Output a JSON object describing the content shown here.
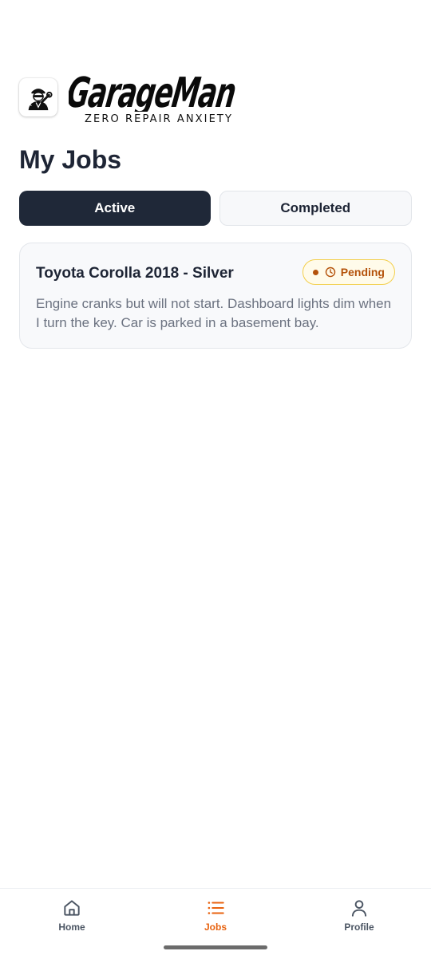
{
  "brand": {
    "icon": "mechanic-logo-icon",
    "name": "GarageMan",
    "tagline": "ZERO REPAIR ANXIETY"
  },
  "page": {
    "title": "My Jobs"
  },
  "tabs": [
    {
      "label": "Active",
      "selected": true
    },
    {
      "label": "Completed",
      "selected": false
    }
  ],
  "jobs": [
    {
      "title": "Toyota Corolla 2018 - Silver",
      "status": "Pending",
      "status_icon": "clock-icon",
      "description": "Engine cranks but will not start. Dashboard lights dim when I turn the key. Car is parked in a basement bay."
    }
  ],
  "nav": {
    "items": [
      {
        "label": "Home",
        "icon": "home-icon",
        "active": false
      },
      {
        "label": "Jobs",
        "icon": "list-icon",
        "active": true
      },
      {
        "label": "Profile",
        "icon": "person-icon",
        "active": false
      }
    ]
  },
  "colors": {
    "primary_dark": "#1f2838",
    "accent": "#e8620f",
    "pending_text": "#b4520a",
    "pending_bg": "#fffbea",
    "pending_border": "#f3cf4b"
  }
}
